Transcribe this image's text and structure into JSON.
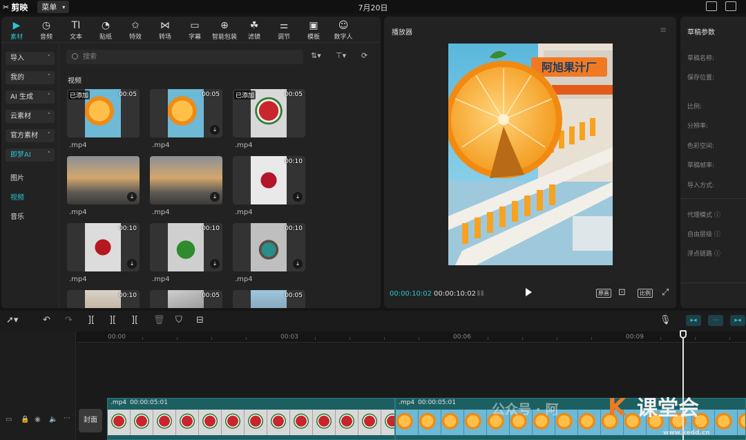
{
  "app": {
    "name": "剪映",
    "menu_label": "菜单",
    "window_title": "7月20日"
  },
  "toolbar": [
    {
      "label": "素材",
      "icon": "media-icon",
      "glyph": "▶",
      "active": true
    },
    {
      "label": "音频",
      "icon": "audio-icon",
      "glyph": "◷"
    },
    {
      "label": "文本",
      "icon": "text-icon",
      "glyph": "TI"
    },
    {
      "label": "贴纸",
      "icon": "sticker-icon",
      "glyph": "◔"
    },
    {
      "label": "特效",
      "icon": "effects-icon",
      "glyph": "✩"
    },
    {
      "label": "转场",
      "icon": "transition-icon",
      "glyph": "⋈"
    },
    {
      "label": "字幕",
      "icon": "subtitle-icon",
      "glyph": "▭"
    },
    {
      "label": "智能包装",
      "icon": "smart-pack-icon",
      "glyph": "⊕"
    },
    {
      "label": "滤镜",
      "icon": "filter-icon",
      "glyph": "☘"
    },
    {
      "label": "调节",
      "icon": "adjust-icon",
      "glyph": "⚌"
    },
    {
      "label": "模板",
      "icon": "template-icon",
      "glyph": "▣"
    },
    {
      "label": "数字人",
      "icon": "digital-human-icon",
      "glyph": "☺"
    }
  ],
  "sidebar": {
    "buttons": [
      "导入",
      "我的",
      "AI 生成",
      "云素材",
      "官方素材",
      "即梦AI"
    ],
    "links": [
      "图片",
      "视频",
      "音乐"
    ]
  },
  "search": {
    "placeholder": "搜索"
  },
  "media": {
    "section_title": "视频",
    "added_label": "已添加",
    "items": [
      {
        "duration": "00:05",
        "ext": ".mp4",
        "added": true,
        "thumb": "orange"
      },
      {
        "duration": "00:05",
        "ext": ".mp4",
        "added": false,
        "thumb": "orange"
      },
      {
        "duration": "00:05",
        "ext": ".mp4",
        "added": true,
        "thumb": "watermelon"
      },
      {
        "duration": "",
        "ext": ".mp4",
        "added": false,
        "thumb": "street"
      },
      {
        "duration": "",
        "ext": ".mp4",
        "added": false,
        "thumb": "street"
      },
      {
        "duration": "00:10",
        "ext": ".mp4",
        "added": false,
        "thumb": "strawberry"
      },
      {
        "duration": "00:10",
        "ext": ".mp4",
        "added": false,
        "thumb": "apple"
      },
      {
        "duration": "00:10",
        "ext": ".mp4",
        "added": false,
        "thumb": "melon"
      },
      {
        "duration": "00:10",
        "ext": ".mp4",
        "added": false,
        "thumb": "kiwi"
      },
      {
        "duration": "00:10",
        "ext": "",
        "added": false,
        "thumb": "wood"
      },
      {
        "duration": "00:05",
        "ext": "",
        "added": false,
        "thumb": "knife"
      },
      {
        "duration": "00:05",
        "ext": "",
        "added": false,
        "thumb": "sky"
      }
    ]
  },
  "player": {
    "title": "播放器",
    "sign_text": "阿旭果汁厂",
    "current_time": "00:00:10:02",
    "total_time": "00:00:10:02",
    "btn_quality": "原画",
    "btn_ratio": "比例"
  },
  "draft": {
    "title": "草稿参数",
    "labels": [
      "草稿名称:",
      "保存位置:",
      "比例:",
      "分辨率:",
      "色彩空间:",
      "草稿帧率:",
      "导入方式:",
      "代理模式",
      "自由层级",
      "浮点链路"
    ]
  },
  "timeline": {
    "ticks": [
      "00:00",
      "00:03",
      "00:06",
      "00:09"
    ],
    "cover_label": "封面",
    "clips": [
      {
        "ext": ".mp4",
        "duration": "00:00:05:01",
        "thumb": "watermelon"
      },
      {
        "ext": ".mp4",
        "duration": "00:00:05:01",
        "thumb": "orange"
      }
    ]
  },
  "watermark": {
    "text1": "公众号 · 阿",
    "text2": "课堂会",
    "url": "www.kedd.cn"
  },
  "colors": {
    "accent": "#2bc4cf",
    "clip": "#1c5f61",
    "panel": "#222222"
  }
}
